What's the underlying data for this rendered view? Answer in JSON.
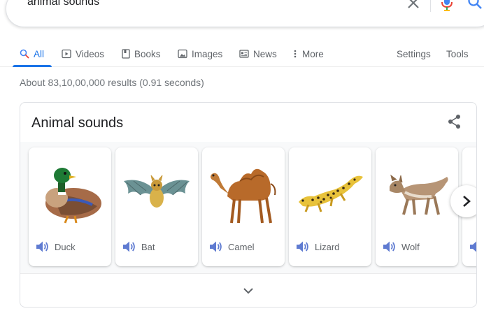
{
  "search": {
    "query": "animal sounds"
  },
  "tabs": [
    {
      "label": "All",
      "icon": "search-icon",
      "active": true
    },
    {
      "label": "Videos",
      "icon": "video-icon"
    },
    {
      "label": "Books",
      "icon": "book-icon"
    },
    {
      "label": "Images",
      "icon": "image-icon"
    },
    {
      "label": "News",
      "icon": "news-icon"
    },
    {
      "label": "More",
      "icon": "more-vert-icon"
    }
  ],
  "tools": {
    "settings": "Settings",
    "tools": "Tools"
  },
  "result_stats": "About 83,10,00,000 results (0.91 seconds)",
  "card": {
    "title": "Animal sounds",
    "animals": [
      {
        "name": "Duck",
        "icon": "duck-image"
      },
      {
        "name": "Bat",
        "icon": "bat-image"
      },
      {
        "name": "Camel",
        "icon": "camel-image"
      },
      {
        "name": "Lizard",
        "icon": "lizard-image"
      },
      {
        "name": "Wolf",
        "icon": "wolf-image"
      }
    ]
  },
  "colors": {
    "accent": "#1a73e8",
    "sound_icon": "#5f7bd1",
    "text_muted": "#70757a"
  }
}
